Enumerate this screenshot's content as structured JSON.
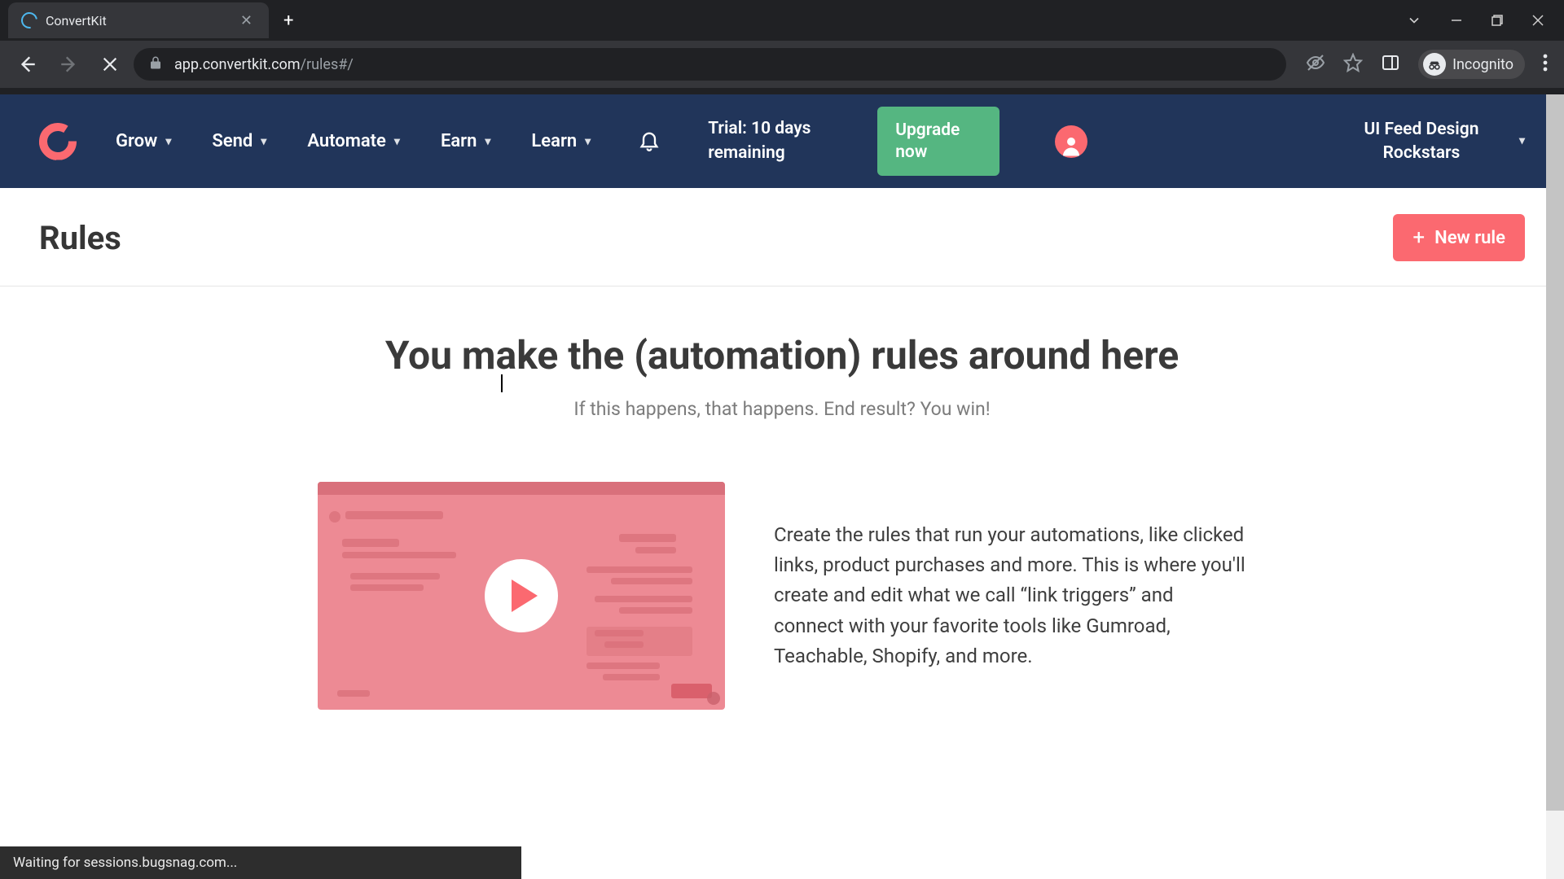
{
  "browser": {
    "tab_title": "ConvertKit",
    "url_host": "app.convertkit.com",
    "url_path": "/rules#/",
    "incognito_label": "Incognito",
    "status_text": "Waiting for sessions.bugsnag.com..."
  },
  "header": {
    "nav": {
      "grow": "Grow",
      "send": "Send",
      "automate": "Automate",
      "earn": "Earn",
      "learn": "Learn"
    },
    "trial": "Trial: 10 days remaining",
    "upgrade": "Upgrade now",
    "account_name": "UI Feed Design Rockstars"
  },
  "page": {
    "title": "Rules",
    "new_rule": "New rule"
  },
  "hero": {
    "title": "You make the (automation) rules around here",
    "subtitle": "If this happens, that happens. End result? You win!",
    "description": "Create the rules that run your automations, like clicked links, product purchases and more. This is where you'll create and edit what we call “link triggers” and connect with your favorite tools like Gumroad, Teachable, Shopify, and more."
  }
}
